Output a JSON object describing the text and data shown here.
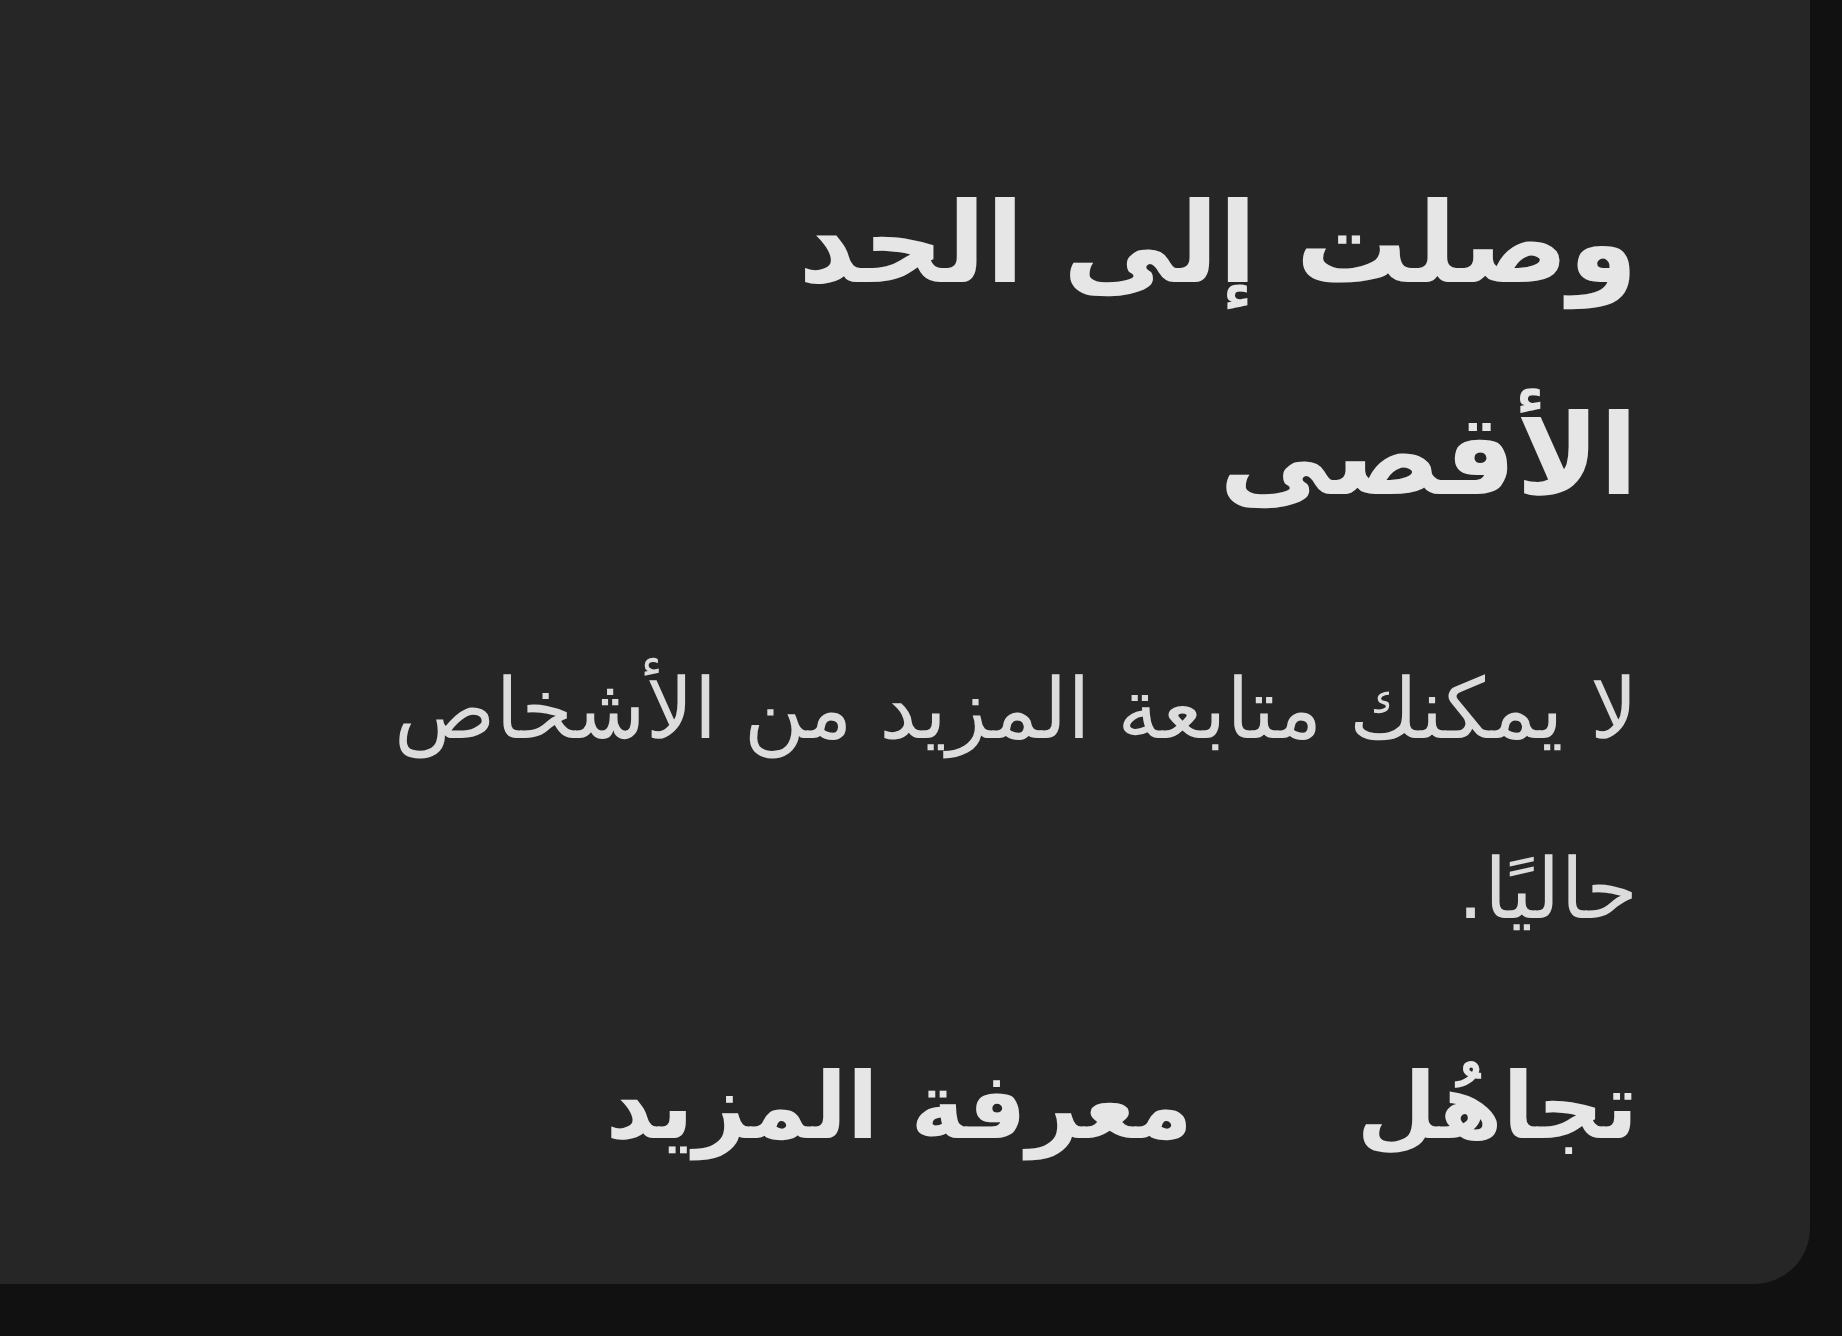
{
  "dialog": {
    "title": "وصلت إلى الحد الأقصى",
    "message": "لا يمكنك متابعة المزيد من الأشخاص حاليًا.",
    "buttons": [
      {
        "label": "تجاهُل"
      },
      {
        "label": "معرفة المزيد"
      }
    ]
  }
}
